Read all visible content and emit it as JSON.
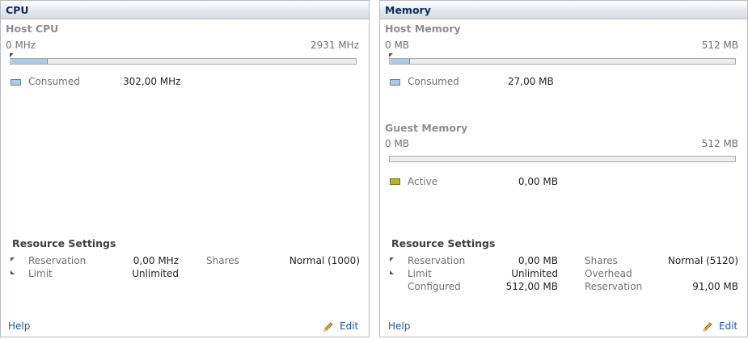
{
  "cpu": {
    "title": "CPU",
    "host_section": "Host CPU",
    "bar_min": "0 MHz",
    "bar_max": "2931 MHz",
    "consumed_label": "Consumed",
    "consumed_value": "302,00 MHz",
    "consumed_fraction": 0.103,
    "resource_settings": "Resource Settings",
    "reservation_label": "Reservation",
    "reservation_value": "0,00 MHz",
    "limit_label": "Limit",
    "limit_value": "Unlimited",
    "shares_label": "Shares",
    "shares_value": "Normal (1000)",
    "help": "Help",
    "edit": "Edit",
    "consumed_color": "#a9cbe9"
  },
  "memory": {
    "title": "Memory",
    "host_section": "Host Memory",
    "host_min": "0 MB",
    "host_max": "512 MB",
    "consumed_label": "Consumed",
    "consumed_value": "27,00 MB",
    "consumed_fraction": 0.053,
    "guest_section": "Guest Memory",
    "guest_min": "0 MB",
    "guest_max": "512 MB",
    "active_label": "Active",
    "active_value": "0,00 MB",
    "active_fraction": 0,
    "active_color": "#b5b42a",
    "resource_settings": "Resource Settings",
    "reservation_label": "Reservation",
    "reservation_value": "0,00 MB",
    "limit_label": "Limit",
    "limit_value": "Unlimited",
    "configured_label": "Configured",
    "configured_value": "512,00 MB",
    "shares_label": "Shares",
    "shares_value": "Normal (5120)",
    "overhead_label": "Overhead",
    "overhead_reservation_label": "Reservation",
    "overhead_reservation_value": "91,00 MB",
    "help": "Help",
    "edit": "Edit"
  }
}
